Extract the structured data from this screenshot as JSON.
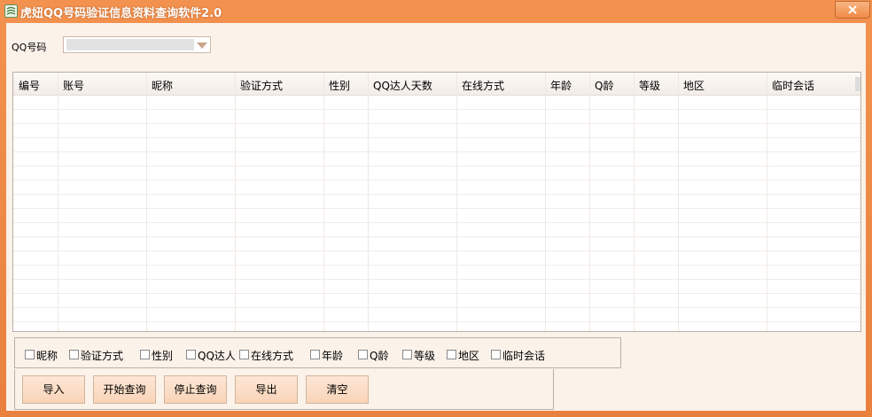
{
  "window": {
    "title": "虎妞QQ号码验证信息资料查询软件2.0",
    "close_label": "×"
  },
  "qq_field": {
    "label": "QQ号码",
    "value": ""
  },
  "table": {
    "columns": [
      "编号",
      "账号",
      "昵称",
      "验证方式",
      "性别",
      "QQ达人天数",
      "在线方式",
      "年龄",
      "Q龄",
      "等级",
      "地区",
      "临时会话"
    ],
    "rows": []
  },
  "options": {
    "items": [
      "昵称",
      "验证方式",
      "性别",
      "QQ达人",
      "在线方式",
      "年龄",
      "Q龄",
      "等级",
      "地区",
      "临时会话"
    ],
    "checked": [
      false,
      false,
      false,
      false,
      false,
      false,
      false,
      false,
      false,
      false
    ]
  },
  "buttons": {
    "import_label": "导入",
    "start_label": "开始查询",
    "stop_label": "停止查询",
    "export_label": "导出",
    "clear_label": "清空"
  },
  "colors": {
    "titlebar": "#ee8a48",
    "client_bg": "#fbf2ea",
    "button_bg": "#fbdcc3"
  }
}
